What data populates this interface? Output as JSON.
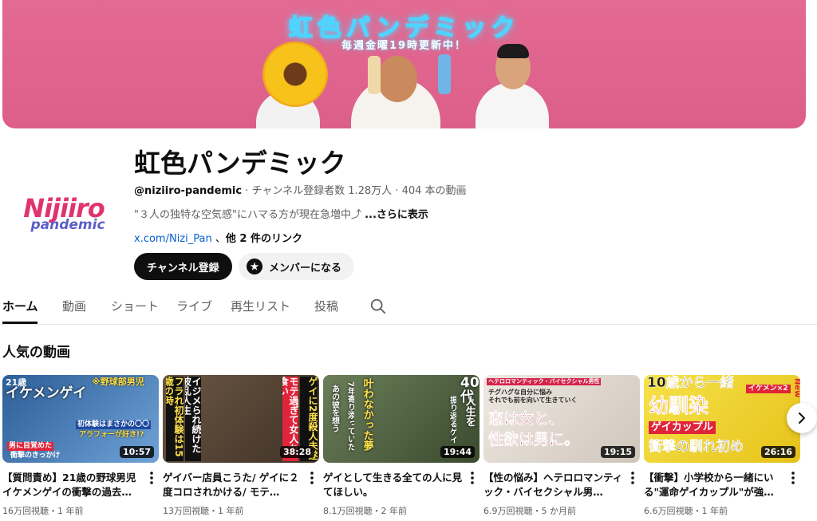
{
  "banner": {
    "title": "虹色パンデミック",
    "subtitle": "毎週金曜19時更新中！"
  },
  "channel": {
    "logo_main": "Nijiiro",
    "logo_sub": "pandemic",
    "name": "虹色パンデミック",
    "handle": "@niziiro-pandemic",
    "meta": " · チャンネル登録者数 1.28万人 · 404 本の動画",
    "description": "\"３人の独特な空気感\"にハマる方が現在急増中⤴︎ ",
    "more_label": "...さらに表示",
    "link_url": "x.com/Nizi_Pan",
    "link_sep": " 、",
    "other_links": "他 2 件のリンク",
    "subscribe_label": "チャンネル登録",
    "member_label": "メンバーになる"
  },
  "tabs": [
    "ホーム",
    "動画",
    "ショート",
    "ライブ",
    "再生リスト",
    "投稿"
  ],
  "section_title": "人気の動画",
  "videos": [
    {
      "title": "【質問責め】21歳の野球男児イケメンゲイの衝撃の過去…",
      "meta": "16万回視聴・1 年前",
      "duration": "10:57",
      "thumb_lines": [
        "21歳",
        "イケメンゲイ",
        "※野球部男児",
        "初体験はまさかの〇〇",
        "アラフォーが好き!?",
        "男に目覚めた",
        "衝撃のきっかけ"
      ],
      "colors": {
        "bg": "#3a6ea8",
        "accent": "#ffffff",
        "hi": "#ffe14a",
        "red": "#e0243a"
      }
    },
    {
      "title": "ゲイバー店員こうた/ ゲイに２度コロされかける/ モテ…",
      "meta": "13万回視聴・1 年前",
      "duration": "38:28",
      "thumb_lines": [
        "フラれ初体験は15歳の時",
        "イジメられ続けた波乱人生",
        "モテ過ぎて女人れ食い",
        "ゲイに2度殺人未遂"
      ],
      "colors": {
        "bg": "#5a4a3a",
        "accent": "#ffe14a",
        "hi": "#ffffff",
        "red": "#e0243a"
      }
    },
    {
      "title": "ゲイとして生きる全ての人に見てほしい。",
      "meta": "8.1万回視聴・2 年前",
      "duration": "19:44",
      "thumb_lines": [
        "叶わなかった夢",
        "7年寄り添っていた",
        "あの彼を想う",
        "40代",
        "人生を",
        "振り返るゲイ"
      ],
      "colors": {
        "bg": "#4c6a3a",
        "accent": "#ffffff",
        "hi": "#ffe14a",
        "red": "#e0243a"
      }
    },
    {
      "title": "【性の悩み】ヘテロロマンティック・バイセクシャル男…",
      "meta": "6.9万回視聴・5 か月前",
      "duration": "19:15",
      "thumb_lines": [
        "ヘテロロマンティック・バイセクシャル男性",
        "チグハグな自分に悩み",
        "それでも前を向いて生きていく",
        "恋は女と、",
        "性欲は男に。"
      ],
      "colors": {
        "bg": "#e9e4de",
        "accent": "#d4234a",
        "hi": "#2a2a2a",
        "red": "#d4234a"
      }
    },
    {
      "title": "【衝撃】小学校から一緒にいる\"運命ゲイカップル\"が強…",
      "meta": "6.6万回視聴・1 年前",
      "duration": "26:16",
      "thumb_lines": [
        "10歳から一緒",
        "幼馴染",
        "ゲイカップル",
        "衝撃の馴れ初め",
        "イケメン×2",
        "New"
      ],
      "colors": {
        "bg": "#f2dd3a",
        "accent": "#e0243a",
        "hi": "#1a1a1a",
        "red": "#e0243a"
      }
    }
  ]
}
